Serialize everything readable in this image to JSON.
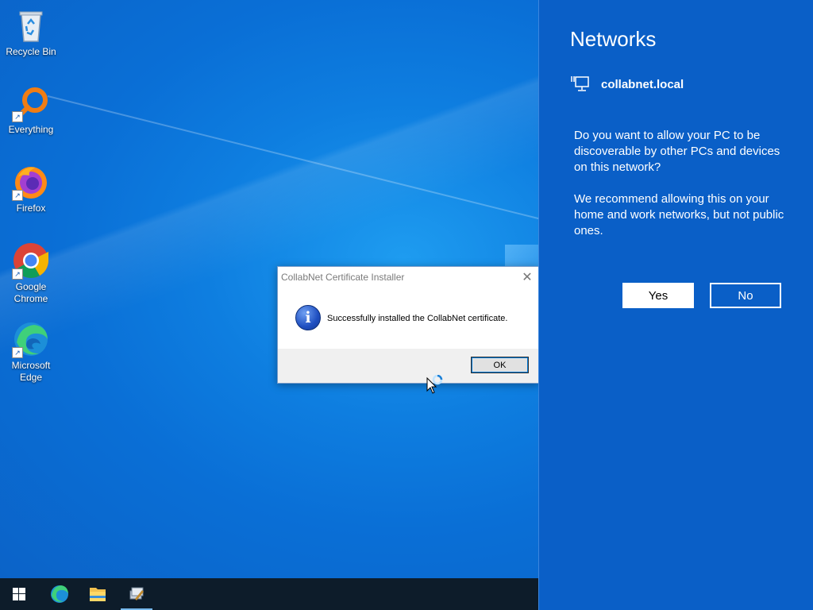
{
  "desktop": {
    "icons": [
      {
        "label": "Recycle Bin",
        "icon": "recycle-bin-icon"
      },
      {
        "label": "Everything",
        "icon": "everything-search-icon"
      },
      {
        "label": "Firefox",
        "icon": "firefox-icon"
      },
      {
        "label": "Google Chrome",
        "icon": "chrome-icon"
      },
      {
        "label": "Microsoft Edge",
        "icon": "edge-icon"
      }
    ]
  },
  "dialog": {
    "title": "CollabNet Certificate Installer",
    "close_glyph": "✕",
    "icon": "info-icon",
    "message": "Successfully installed the CollabNet certificate.",
    "ok_label": "OK"
  },
  "taskbar": {
    "items": [
      {
        "icon": "windows-start-icon"
      },
      {
        "icon": "edge-icon"
      },
      {
        "icon": "file-explorer-icon"
      },
      {
        "icon": "certificate-installer-icon",
        "active": true
      }
    ]
  },
  "flyout": {
    "title": "Networks",
    "network_name": "collabnet.local",
    "question": "Do you want to allow your PC to be discoverable by other PCs and devices on this network?",
    "recommendation": "We recommend allowing this on your home and work networks, but not public ones.",
    "yes_label": "Yes",
    "no_label": "No",
    "background_color": "#0a5fc7"
  }
}
